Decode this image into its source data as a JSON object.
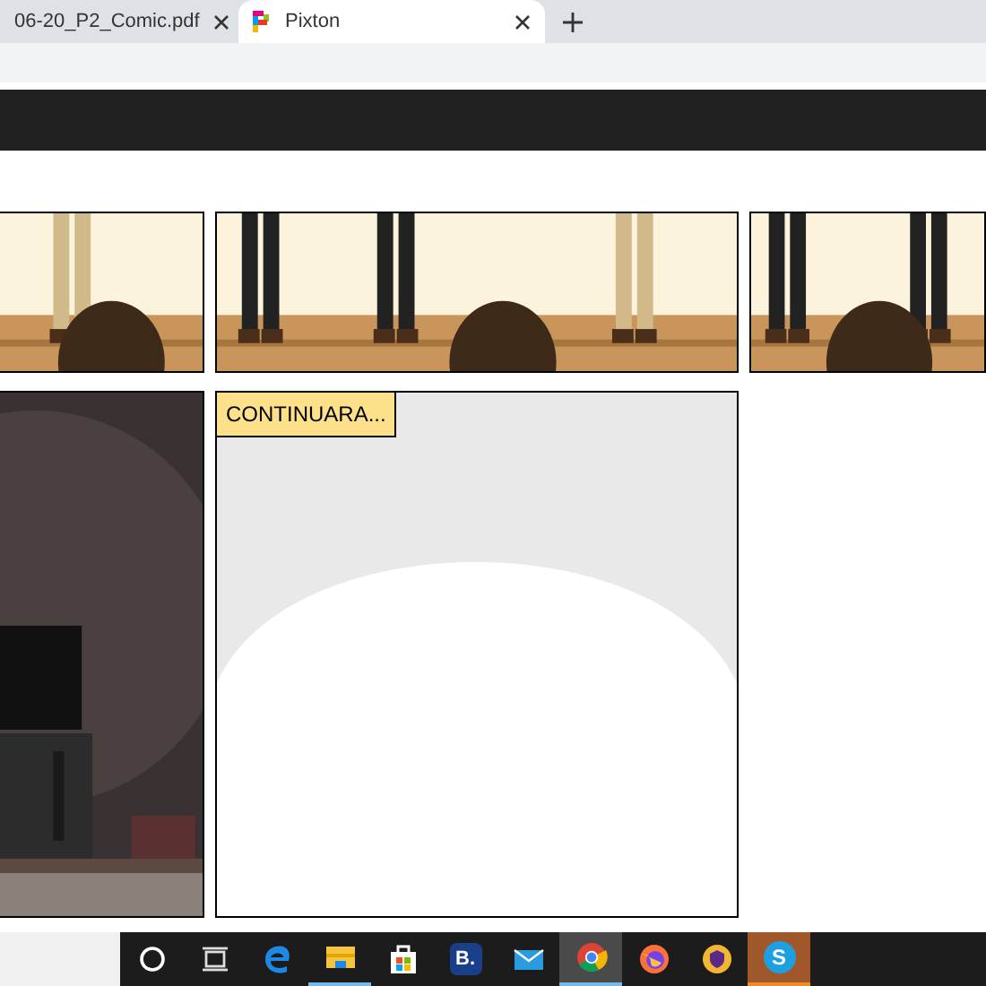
{
  "tabs": [
    {
      "title": "06-20_P2_Comic.pdf",
      "selected": false,
      "kind": "pdf"
    },
    {
      "title": "Pixton",
      "selected": true,
      "kind": "pixton"
    }
  ],
  "comic": {
    "rows": [
      [
        {
          "kind": "picture"
        },
        {
          "kind": "picture"
        },
        {
          "kind": "picture"
        }
      ],
      [
        {
          "kind": "picture"
        },
        {
          "kind": "caption",
          "caption": "CONTINUARA..."
        }
      ]
    ]
  },
  "taskbar": [
    {
      "kind": "cortana",
      "active": false,
      "running": false
    },
    {
      "kind": "taskview",
      "active": false,
      "running": false
    },
    {
      "kind": "edge",
      "active": false,
      "running": false
    },
    {
      "kind": "explorer",
      "active": false,
      "running": true
    },
    {
      "kind": "store",
      "active": false,
      "running": false
    },
    {
      "kind": "booking",
      "label": "B.",
      "active": false,
      "running": false
    },
    {
      "kind": "mail",
      "active": false,
      "running": false
    },
    {
      "kind": "chrome",
      "active": true,
      "running": true
    },
    {
      "kind": "firefox",
      "active": false,
      "running": false
    },
    {
      "kind": "vpn",
      "active": false,
      "running": false
    },
    {
      "kind": "skype",
      "label": "S",
      "active": false,
      "running": true,
      "attention": true
    }
  ]
}
